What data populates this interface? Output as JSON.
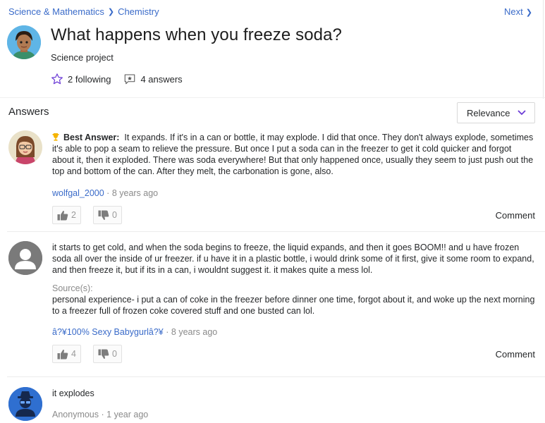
{
  "breadcrumb": {
    "category": "Science & Mathematics",
    "subcategory": "Chemistry"
  },
  "nav": {
    "next_label": "Next"
  },
  "question": {
    "title": "What happens when you freeze soda?",
    "detail": "Science project",
    "following": "2 following",
    "answers_count": "4 answers"
  },
  "answers_section": {
    "heading": "Answers",
    "sort_label": "Relevance"
  },
  "answers": [
    {
      "best_label": "Best Answer:",
      "text": "It expands. If it's in a can or bottle, it may explode. I did that once. They don't always explode, sometimes it's able to pop a seam to relieve the pressure. But once I put a soda can in the freezer to get it cold quicker and forgot about it, then it exploded. There was soda everywhere! But that only happened once, usually they seem to just push out the top and bottom of the can. After they melt, the carbonation is gone, also.",
      "author": "wolfgal_2000",
      "time": "8 years ago",
      "upvotes": "2",
      "downvotes": "0",
      "comment_label": "Comment"
    },
    {
      "text": "it starts to get cold, and when the soda begins to freeze, the liquid expands, and then it goes BOOM!! and u have frozen soda all over the inside of ur freezer. if u have it in a plastic bottle, i would drink some of it first, give it some room to expand, and then freeze it, but if its in a can, i wouldnt suggest it. it makes quite a mess lol.",
      "sources_label": "Source(s):",
      "sources_text": "personal experience- i put a can of coke in the freezer before dinner one time, forgot about it, and woke up the next morning to a freezer full of frozen coke covered stuff and one busted can lol.",
      "author": "â?¥100% Sexy Babygurlâ?¥",
      "time": "8 years ago",
      "upvotes": "4",
      "downvotes": "0",
      "comment_label": "Comment"
    },
    {
      "text": "it explodes",
      "author": "Anonymous",
      "time": "1 year ago"
    }
  ],
  "separator": "·",
  "colors": {
    "link": "#3a6bc9",
    "accent_purple": "#6c3cd6",
    "trophy": "#f5b400"
  },
  "icons": [
    "chevron-right-icon",
    "star-outline-icon",
    "answer-flag-icon",
    "chevron-down-icon",
    "trophy-icon",
    "thumbs-up-icon",
    "thumbs-down-icon"
  ]
}
